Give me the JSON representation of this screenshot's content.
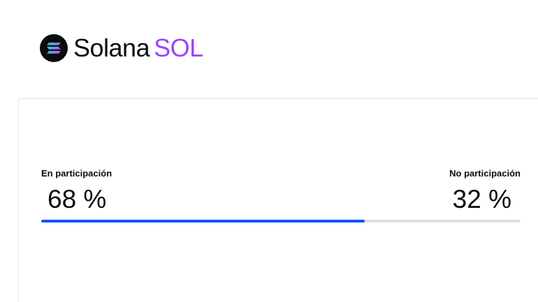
{
  "asset": {
    "name": "Solana",
    "symbol": "SOL",
    "icon": "solana-logo-icon",
    "symbol_color": "#9945ff"
  },
  "staking": {
    "staked_label": "En participación",
    "staked_value": "68 %",
    "unstaked_label": "No participación",
    "unstaked_value": "32 %",
    "staked_fraction": 0.675,
    "bar_color": "#0052ff",
    "track_color": "#dee1e6"
  }
}
